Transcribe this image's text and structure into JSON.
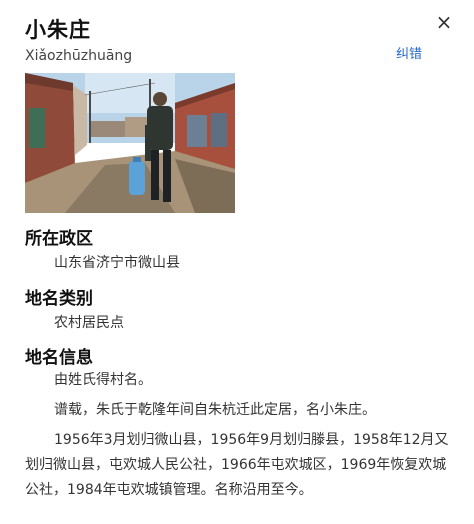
{
  "header": {
    "title": "小朱庄",
    "pinyin": "Xiǎozhūzhuāng",
    "close_glyph": "×",
    "report_label": "纠错"
  },
  "photo": {
    "icon": "village-street-photo"
  },
  "sections": {
    "region": {
      "heading": "所在政区",
      "value": "山东省济宁市微山县"
    },
    "category": {
      "heading": "地名类别",
      "value": "农村居民点"
    },
    "info": {
      "heading": "地名信息",
      "paragraphs": [
        "由姓氏得村名。",
        "谱载，朱氏于乾隆年间自朱杭迁此定居，名小朱庄。",
        "1956年3月划归微山县，1956年9月划归滕县，1958年12月又划归微山县，屯欢城人民公社，1966年屯欢城区，1969年恢复欢城公社，1984年屯欢城镇管理。名称沿用至今。"
      ]
    }
  },
  "colors": {
    "link": "#2468c4",
    "text": "#333333",
    "heading": "#111111"
  }
}
